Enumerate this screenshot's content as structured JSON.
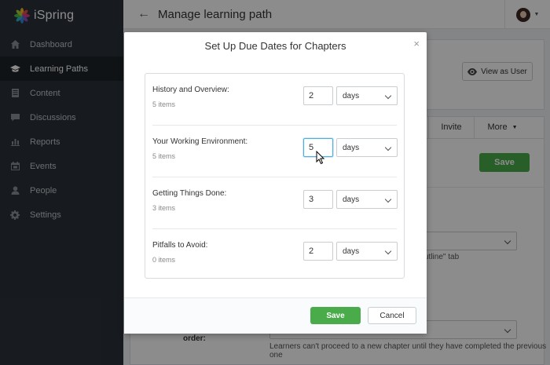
{
  "app": {
    "logo": "iSpring"
  },
  "sidebar": {
    "items": [
      {
        "label": "Dashboard",
        "icon": "home-icon"
      },
      {
        "label": "Learning Paths",
        "icon": "graduation-cap-icon",
        "active": true
      },
      {
        "label": "Content",
        "icon": "document-icon"
      },
      {
        "label": "Discussions",
        "icon": "chat-icon"
      },
      {
        "label": "Reports",
        "icon": "bar-chart-icon"
      },
      {
        "label": "Events",
        "icon": "calendar-icon"
      },
      {
        "label": "People",
        "icon": "person-icon"
      },
      {
        "label": "Settings",
        "icon": "gear-icon"
      }
    ]
  },
  "header": {
    "back": "←",
    "title": "Manage learning path"
  },
  "background": {
    "view_as_user": "View as User",
    "tab_invite": "Invite",
    "tab_more": "More",
    "save": "Save",
    "outline_hint": "utline\" tab",
    "order_label": "order:",
    "order_hint": "Learners can't proceed to a new chapter until they have completed the previous one"
  },
  "modal": {
    "title": "Set Up Due Dates for Chapters",
    "close": "×",
    "chapters": [
      {
        "name": "History and Overview:",
        "items": "5 items",
        "value": "2",
        "unit": "days"
      },
      {
        "name": "Your Working Environment:",
        "items": "5 items",
        "value": "5",
        "unit": "days",
        "focused": true
      },
      {
        "name": "Getting Things Done:",
        "items": "3 items",
        "value": "3",
        "unit": "days"
      },
      {
        "name": "Pitfalls to Avoid:",
        "items": "0 items",
        "value": "2",
        "unit": "days"
      }
    ],
    "save": "Save",
    "cancel": "Cancel"
  },
  "colors": {
    "accent_green": "#4aab4a",
    "sidebar": "#2b3239",
    "focus": "#4ab0e0"
  }
}
